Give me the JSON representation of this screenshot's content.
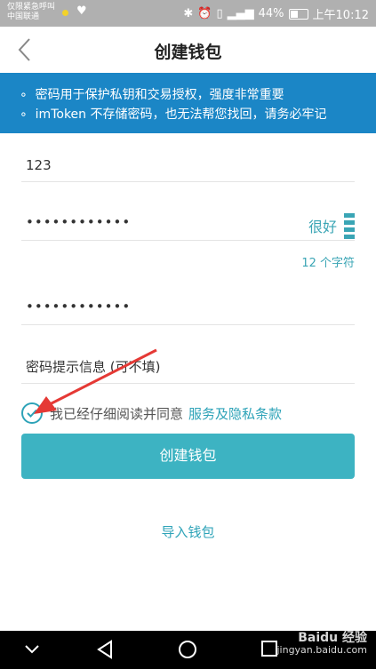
{
  "status": {
    "carrier_line1": "仅限紧急呼叫",
    "carrier_line2": "中国联通",
    "battery": "44%",
    "time": "上午10:12"
  },
  "header": {
    "title": "创建钱包"
  },
  "notice": {
    "line1": "密码用于保护私钥和交易授权，强度非常重要",
    "line2": "imToken 不存储密码，也无法帮您找回，请务必牢记"
  },
  "form": {
    "wallet_name": "123",
    "password_mask": "••••••••••••",
    "strength_label": "很好",
    "char_count": "12 个字符",
    "repeat_mask": "••••••••••••",
    "hint_placeholder": "密码提示信息 (可不填)"
  },
  "agreement": {
    "text": "我已经仔细阅读并同意",
    "link": "服务及隐私条款"
  },
  "buttons": {
    "create": "创建钱包",
    "import": "导入钱包"
  },
  "watermark": {
    "brand": "Baidu 经验",
    "url": "jingyan.baidu.com"
  },
  "colors": {
    "accent": "#3db3c2",
    "notice_bg": "#1b86c6",
    "arrow": "#e53935"
  }
}
